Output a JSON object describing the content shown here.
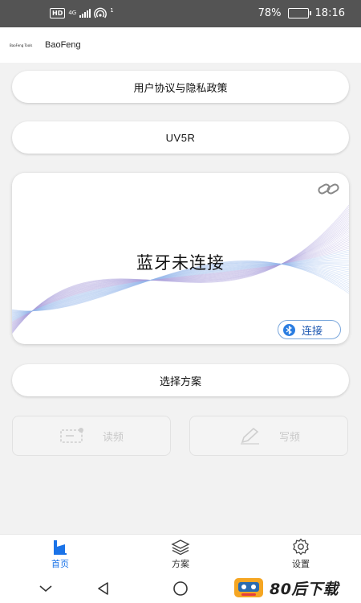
{
  "status_bar": {
    "network_badge": "HD",
    "network_type": "4G",
    "hotspot_count": "1",
    "battery_percent": "78%",
    "battery_level": 0.78,
    "time": "18:16"
  },
  "app_header": {
    "logo_text": "BaoFeng Tools",
    "title": "BaoFeng"
  },
  "main": {
    "agreement_button": "用户协议与隐私政策",
    "model_button": "UV5R",
    "bluetooth_card": {
      "status_text": "蓝牙未连接",
      "connect_label": "连接"
    },
    "choose_scheme_button": "选择方案",
    "read_label": "读频",
    "write_label": "写频"
  },
  "tabs": [
    {
      "label": "首页",
      "icon": "home-icon",
      "active": true
    },
    {
      "label": "方案",
      "icon": "layers-icon",
      "active": false
    },
    {
      "label": "设置",
      "icon": "gear-icon",
      "active": false
    }
  ],
  "watermark": {
    "text": "80后下载"
  },
  "colors": {
    "accent": "#1a73e8",
    "connect_text": "#1a56b0",
    "bluetooth_icon": "#2a7de1",
    "status_bar_bg": "#545454",
    "page_bg": "#f2f2f2",
    "disabled_text": "#c9c9c9"
  }
}
